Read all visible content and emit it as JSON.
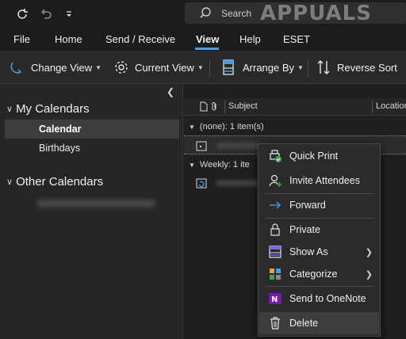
{
  "title_bar": {
    "search_placeholder": "Search",
    "watermark_text": "APPUALS",
    "icons": [
      "sync-icon",
      "undo-icon",
      "customize-toolbar-icon"
    ]
  },
  "menu": {
    "items": [
      "File",
      "Home",
      "Send / Receive",
      "View",
      "Help",
      "ESET"
    ],
    "active": "View"
  },
  "ribbon": {
    "change_view": "Change View",
    "current_view": "Current View",
    "arrange_by": "Arrange By",
    "reverse_sort": "Reverse Sort"
  },
  "nav": {
    "my_calendars": "My Calendars",
    "calendar": "Calendar",
    "birthdays": "Birthdays",
    "other_calendars": "Other Calendars"
  },
  "list": {
    "subject_header": "Subject",
    "location_header": "Location",
    "group_none": "(none): 1 item(s)",
    "group_weekly": "Weekly: 1 ite"
  },
  "context_menu": {
    "items": [
      {
        "label": "Quick Print",
        "icon": "quick-print-icon"
      },
      {
        "label": "Invite Attendees",
        "icon": "invite-attendees-icon"
      },
      {
        "label": "Forward",
        "icon": "forward-arrow-icon"
      },
      {
        "label": "Private",
        "icon": "lock-icon"
      },
      {
        "label": "Show As",
        "icon": "show-as-icon",
        "submenu": true
      },
      {
        "label": "Categorize",
        "icon": "categorize-icon",
        "submenu": true
      },
      {
        "label": "Send to OneNote",
        "icon": "onenote-icon"
      },
      {
        "label": "Delete",
        "icon": "trash-icon"
      }
    ],
    "hovered": "Delete"
  },
  "colors": {
    "accent": "#4a9be6",
    "background": "#1f1f1f",
    "menu_bg": "#2b2b2b",
    "onenote_purple": "#7719aa"
  }
}
